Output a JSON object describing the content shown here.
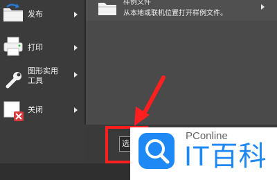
{
  "sidebar": {
    "items": [
      {
        "label": "发布",
        "icon": "publish-folder-icon"
      },
      {
        "label": "打印",
        "icon": "printer-icon"
      },
      {
        "label": "图形实用\n工具",
        "icon": "wrench-icon"
      },
      {
        "label": "关闭",
        "icon": "close-document-icon"
      }
    ]
  },
  "content": {
    "row": {
      "title_partial": "样例文件",
      "description": "从本地或联机位置打开样例文件。"
    }
  },
  "bottom": {
    "select_button_text": "选"
  },
  "watermark": {
    "brand": "PConline",
    "text": "IT百科"
  },
  "colors": {
    "highlight": "#ff1f1f",
    "watermark_blue": "#1e88f5"
  }
}
